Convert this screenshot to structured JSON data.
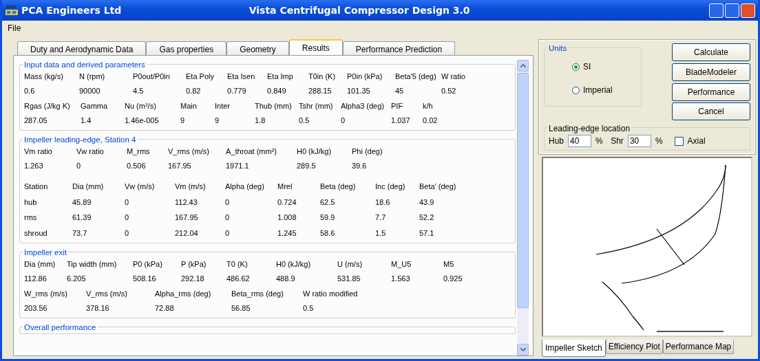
{
  "window": {
    "company": "PCA Engineers Ltd",
    "title": "Vista Centrifugal Compressor Design 3.0"
  },
  "menu": [
    "File"
  ],
  "tabs": [
    {
      "label": "Duty and Aerodynamic Data",
      "selected": false
    },
    {
      "label": "Gas properties",
      "selected": false
    },
    {
      "label": "Geometry",
      "selected": false
    },
    {
      "label": "Results",
      "selected": true
    },
    {
      "label": "Performance Prediction",
      "selected": false
    }
  ],
  "sections": [
    {
      "title": "Input data and derived parameters",
      "field_rows": [
        [
          {
            "label": "Mass (kg/s)",
            "value": "0.6"
          },
          {
            "label": "N (rpm)",
            "value": "90000"
          },
          {
            "label": "P0out/P0in",
            "value": "4.5"
          },
          {
            "label": "Eta Poly",
            "value": "0.82"
          },
          {
            "label": "Eta Isen",
            "value": "0.779"
          },
          {
            "label": "Eta Imp",
            "value": "0.849"
          },
          {
            "label": "T0in (K)",
            "value": "288.15"
          },
          {
            "label": "P0in (kPa)",
            "value": "101.35"
          },
          {
            "label": "Beta'5 (deg)",
            "value": "45"
          },
          {
            "label": "W ratio",
            "value": "0.52"
          }
        ],
        [
          {
            "label": "Rgas (J/kg K)",
            "value": "287.05"
          },
          {
            "label": "Gamma",
            "value": "1.4"
          },
          {
            "label": "Nu (m²/s)",
            "value": "1.46e-005"
          },
          {
            "label": "Main",
            "value": "9"
          },
          {
            "label": "Inter",
            "value": "9"
          },
          {
            "label": "Thub (mm)",
            "value": "1.8"
          },
          {
            "label": "Tshr (mm)",
            "value": "0.5"
          },
          {
            "label": "Alpha3 (deg)",
            "value": "0"
          },
          {
            "label": "PIF",
            "value": "1.037"
          },
          {
            "label": "k/h",
            "value": "0.02"
          }
        ]
      ]
    },
    {
      "title": "Impeller leading-edge, Station 4",
      "field_rows": [
        [
          {
            "label": "Vm ratio",
            "value": "1.263"
          },
          {
            "label": "Vw ratio",
            "value": "0"
          },
          {
            "label": "M_rms",
            "value": "0.506"
          },
          {
            "label": "V_rms (m/s)",
            "value": "167.95"
          },
          {
            "label": "A_throat (mm²)",
            "value": "1971.1"
          },
          {
            "label": "H0 (kJ/kg)",
            "value": "289.5"
          },
          {
            "label": "Phi (deg)",
            "value": "39.6"
          }
        ]
      ],
      "table": {
        "columns": [
          "Station",
          "Dia (mm)",
          "Vw (m/s)",
          "Vm (m/s)",
          "Alpha (deg)",
          "Mrel",
          "Beta (deg)",
          "Inc (deg)",
          "Beta' (deg)"
        ],
        "rows": [
          [
            "hub",
            "45.89",
            "0",
            "112.43",
            "0",
            "0.724",
            "62.5",
            "18.6",
            "43.9"
          ],
          [
            "rms",
            "61.39",
            "0",
            "167.95",
            "0",
            "1.008",
            "59.9",
            "7.7",
            "52.2"
          ],
          [
            "shroud",
            "73.7",
            "0",
            "212.04",
            "0",
            "1.245",
            "58.6",
            "1.5",
            "57.1"
          ]
        ]
      }
    },
    {
      "title": "Impeller exit",
      "field_rows": [
        [
          {
            "label": "Dia (mm)",
            "value": "112.86"
          },
          {
            "label": "Tip width (mm)",
            "value": "6.205"
          },
          {
            "label": "P0 (kPa)",
            "value": "508.16"
          },
          {
            "label": "P (kPa)",
            "value": "292.18"
          },
          {
            "label": "T0 (K)",
            "value": "486.62"
          },
          {
            "label": "H0 (kJ/kg)",
            "value": "488.9"
          },
          {
            "label": "U (m/s)",
            "value": "531.85"
          },
          {
            "label": "M_U5",
            "value": "1.563"
          },
          {
            "label": "M5",
            "value": "0.925"
          }
        ],
        [
          {
            "label": "W_rms (m/s)",
            "value": "203.56"
          },
          {
            "label": "V_rms (m/s)",
            "value": "378.16"
          },
          {
            "label": "Alpha_rms (deg)",
            "value": "72.88"
          },
          {
            "label": "Beta_rms (deg)",
            "value": "56.85"
          },
          {
            "label": "W ratio modified",
            "value": "0.5"
          }
        ]
      ]
    },
    {
      "title": "Overall performance"
    }
  ],
  "units": {
    "title": "Units",
    "options": [
      {
        "label": "SI",
        "selected": true
      },
      {
        "label": "Imperial",
        "selected": false
      }
    ]
  },
  "buttons": [
    "Calculate",
    "BladeModeler",
    "Performance",
    "Cancel"
  ],
  "leading_edge": {
    "title": "Leading-edge location",
    "hub_label": "Hub",
    "hub_value": "40",
    "hub_unit": "%",
    "shr_label": "Shr",
    "shr_value": "30",
    "shr_unit": "%",
    "axial_label": "Axial",
    "axial_checked": false
  },
  "sketch_tabs": [
    {
      "label": "Impeller Sketch",
      "selected": true
    },
    {
      "label": "Efficiency Plot",
      "selected": false
    },
    {
      "label": "Performance Map",
      "selected": false
    }
  ]
}
